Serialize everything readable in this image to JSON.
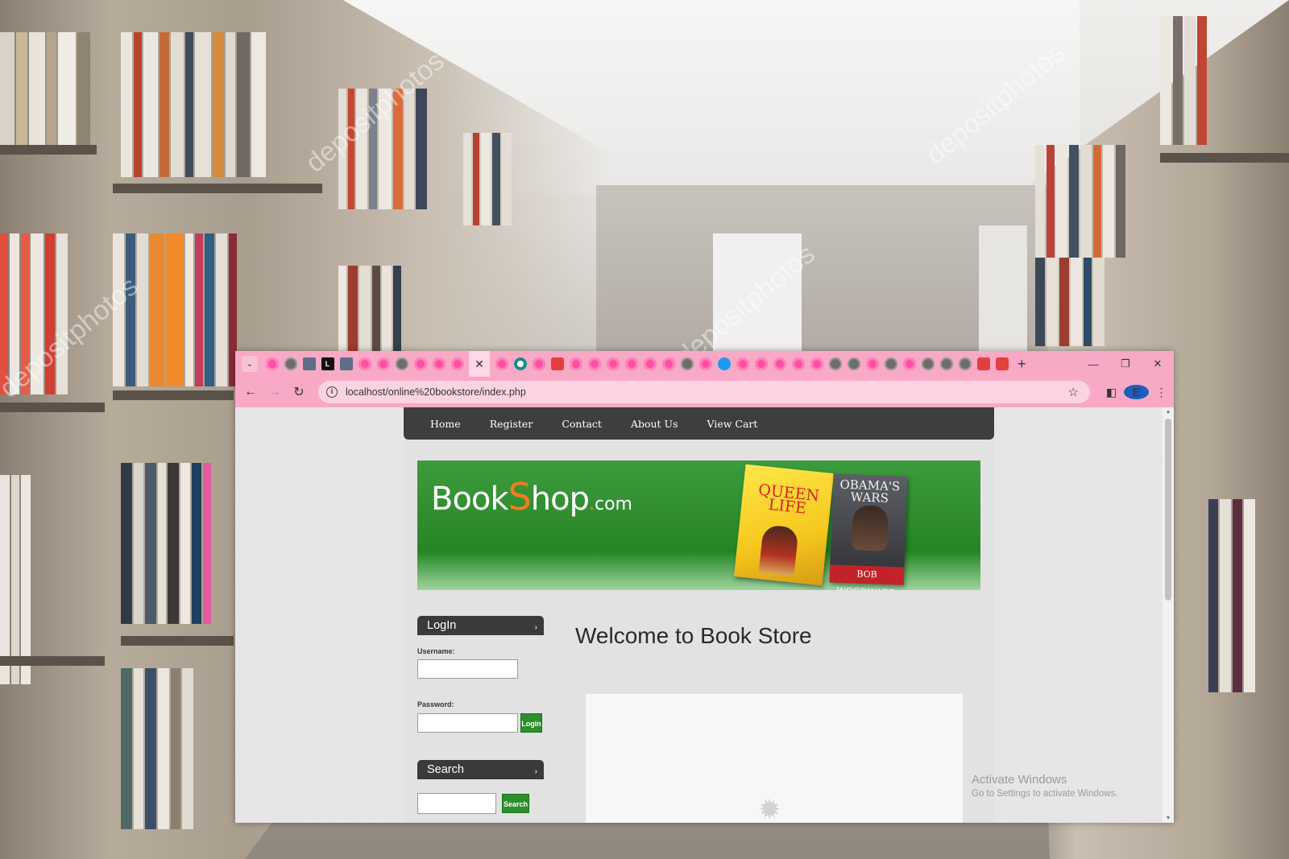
{
  "browser": {
    "address": "localhost/online%20bookstore/index.php",
    "profile_initial": "E"
  },
  "nav": {
    "home": "Home",
    "register": "Register",
    "contact": "Contact",
    "about": "About Us",
    "cart": "View Cart"
  },
  "banner": {
    "logo_pre": "Book",
    "logo_s": "S",
    "logo_post": "hop",
    "logo_dot": ".",
    "logo_tld": "com",
    "book1_title": "QUEEN LIFE",
    "book2_title": "OBAMA'S WARS",
    "book2_author": "BOB WOODWARD"
  },
  "login": {
    "heading": "LogIn",
    "username_label": "Username:",
    "password_label": "Password:",
    "button": "Login"
  },
  "search": {
    "heading": "Search",
    "button": "Search"
  },
  "main": {
    "welcome": "Welcome to Book Store"
  },
  "os": {
    "activate_title": "Activate Windows",
    "activate_sub": "Go to Settings to activate Windows."
  },
  "watermark": "depositphotos"
}
